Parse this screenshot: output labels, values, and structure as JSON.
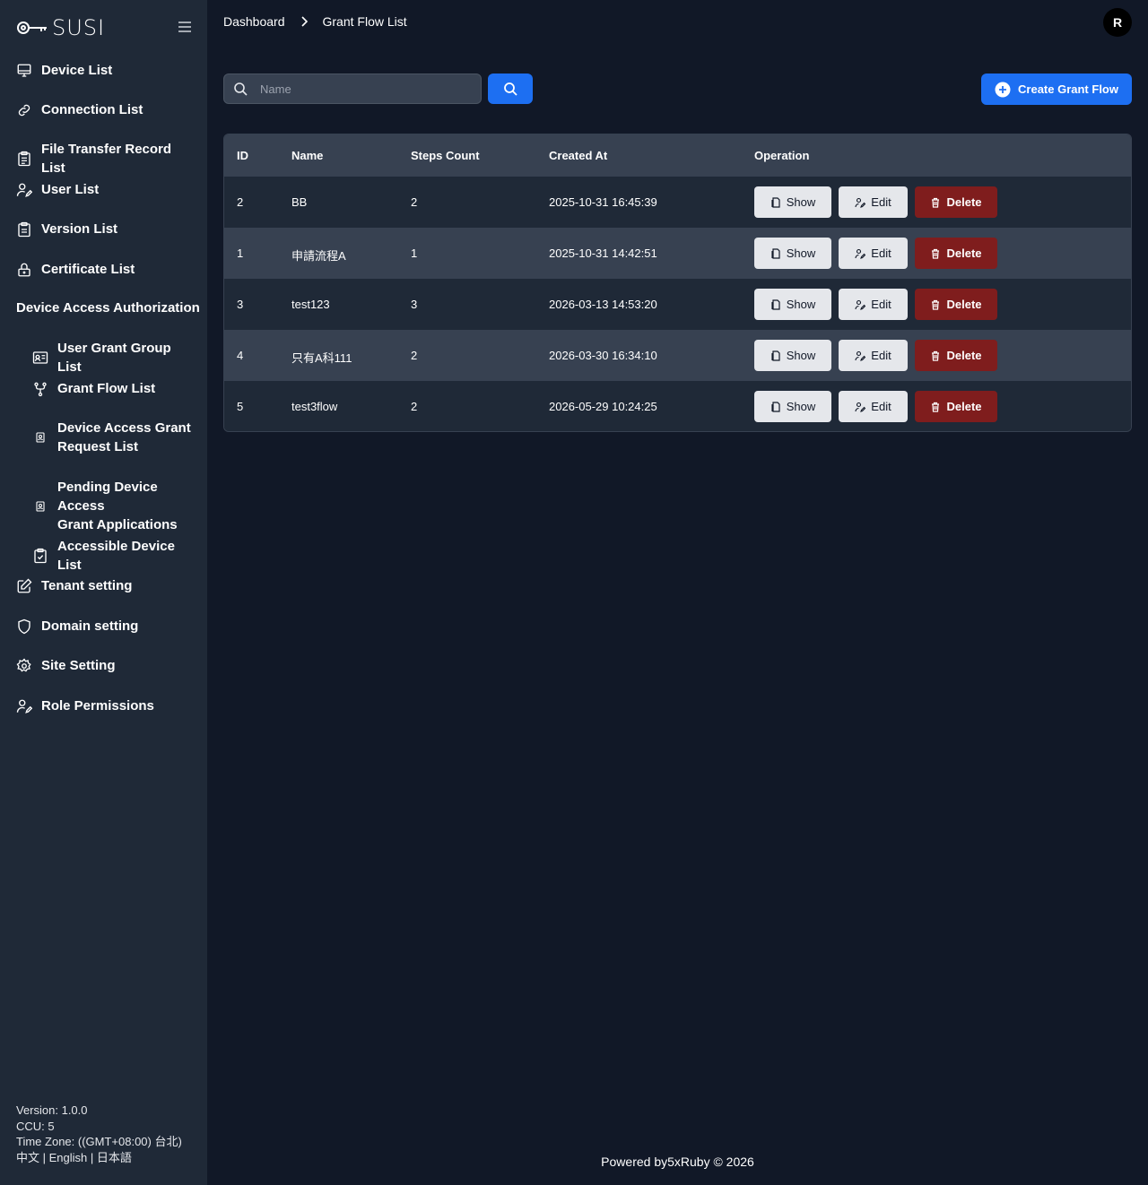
{
  "app": {
    "logo_text": "SUSI"
  },
  "sidebar": {
    "items": [
      {
        "label": "Device List"
      },
      {
        "label": "Connection List"
      },
      {
        "label": "File Transfer Record List"
      },
      {
        "label": "User List"
      },
      {
        "label": "Version List"
      },
      {
        "label": "Certificate List"
      }
    ],
    "section_title": "Device Access Authorization",
    "sub_items": [
      {
        "label": "User Grant Group List"
      },
      {
        "label": "Grant Flow List"
      },
      {
        "label_line1": "Device Access Grant",
        "label_line2": "Request List"
      },
      {
        "label_line1": "Pending Device Access",
        "label_line2": "Grant Applications"
      },
      {
        "label": "Accessible Device List"
      }
    ],
    "bottom_items": [
      {
        "label": "Tenant setting"
      },
      {
        "label": "Domain setting"
      },
      {
        "label": "Site Setting"
      },
      {
        "label": "Role Permissions"
      }
    ],
    "footer": {
      "version": "Version: 1.0.0",
      "ccu": "CCU: 5",
      "timezone": "Time Zone: ((GMT+08:00) 台北)",
      "lang_zh": "中文",
      "lang_en": "English",
      "lang_ja": "日本語",
      "separator": " | "
    }
  },
  "header": {
    "breadcrumb": [
      "Dashboard",
      "Grant Flow List"
    ],
    "avatar_initial": "R"
  },
  "toolbar": {
    "search_placeholder": "Name",
    "search_value": "",
    "create_label": "Create Grant Flow"
  },
  "table": {
    "columns": [
      "ID",
      "Name",
      "Steps Count",
      "Created At",
      "Operation"
    ],
    "rows": [
      {
        "id": "2",
        "name": "BB",
        "steps": "2",
        "created_at": "2025-10-31 16:45:39"
      },
      {
        "id": "1",
        "name": "申請流程A",
        "steps": "1",
        "created_at": "2025-10-31 14:42:51"
      },
      {
        "id": "3",
        "name": "test123",
        "steps": "3",
        "created_at": "2026-03-13 14:53:20"
      },
      {
        "id": "4",
        "name": "只有A科111",
        "steps": "2",
        "created_at": "2026-03-30 16:34:10"
      },
      {
        "id": "5",
        "name": "test3flow",
        "steps": "2",
        "created_at": "2026-05-29 10:24:25"
      }
    ],
    "actions": {
      "show": "Show",
      "edit": "Edit",
      "delete": "Delete"
    }
  },
  "footer": {
    "powered_by": "Powered by5xRuby © 2026"
  },
  "colors": {
    "background": "#111827",
    "sidebar": "#1f2937",
    "primary": "#1d6ff2",
    "danger": "#7f1d1d",
    "row_alt": "#374151"
  }
}
